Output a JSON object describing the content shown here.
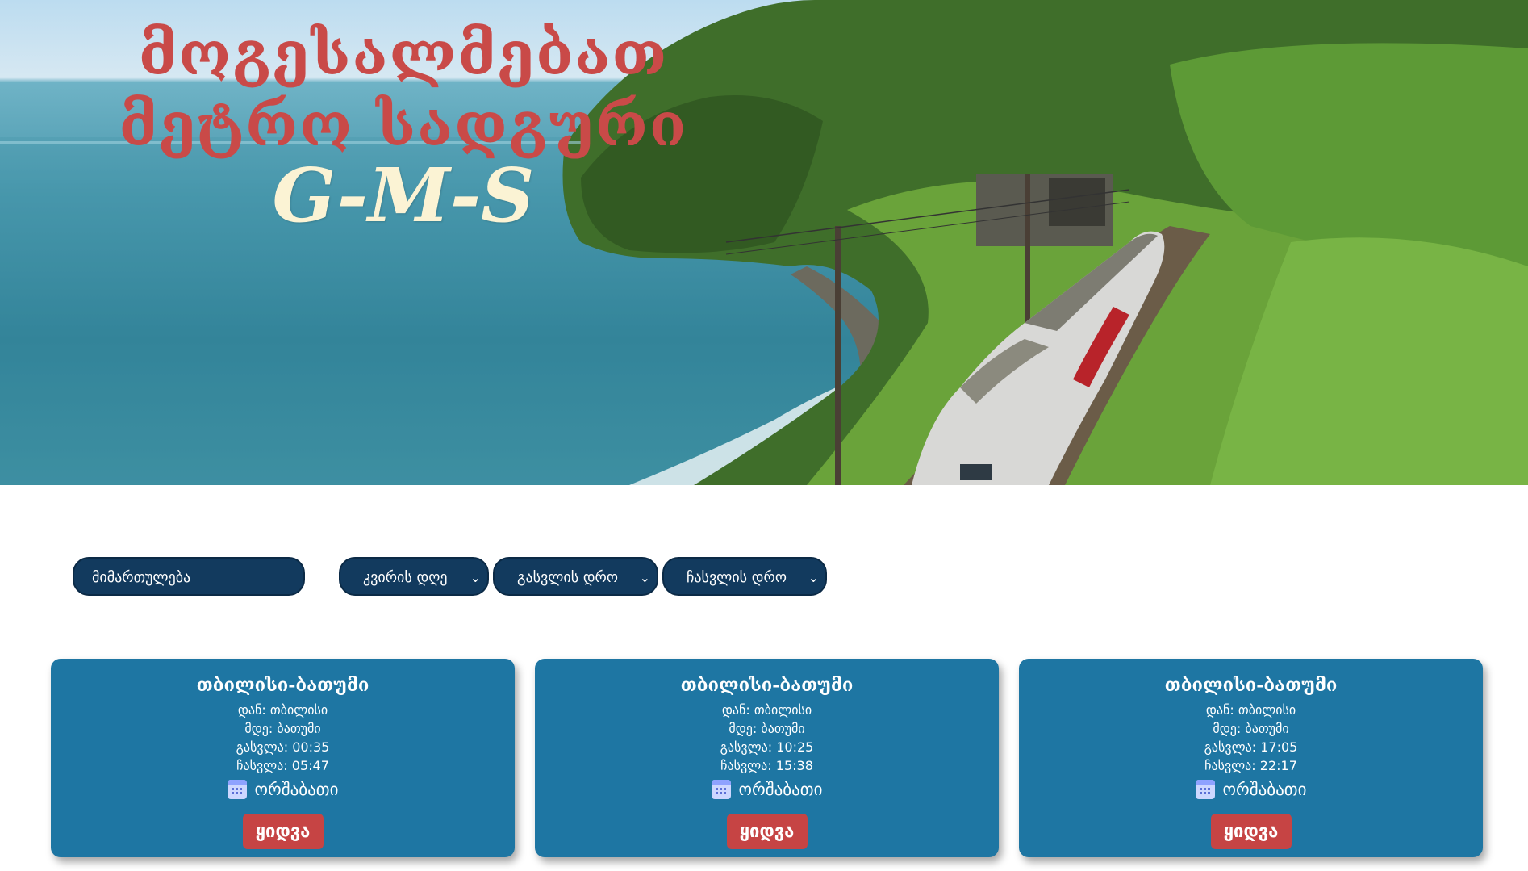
{
  "hero": {
    "title_line1": "მოგესალმებათ",
    "title_line2": "მეტრო სადგური",
    "title_line3": "G-M-S"
  },
  "filters": {
    "direction_placeholder": "მიმართულება",
    "day_select": "კვირის დღე",
    "departure_select": "გასვლის დრო",
    "arrival_select": "ჩასვლის დრო"
  },
  "icons": {
    "chevron": "chevron-down-icon",
    "calendar": "calendar-icon"
  },
  "colors": {
    "title": "#c94a48",
    "title_accent": "#fbf3d4",
    "filter_bg": "#123a5e",
    "card_bg": "#1e76a3",
    "buy_button": "#c64444"
  },
  "cards": [
    {
      "route": "თბილისი-ბათუმი",
      "from": "დან: თბილისი",
      "to": "მდე: ბათუმი",
      "departure": "გასვლა: 00:35",
      "arrival": "ჩასვლა: 05:47",
      "day": "ორშაბათი",
      "buy_label": "ყიდვა"
    },
    {
      "route": "თბილისი-ბათუმი",
      "from": "დან: თბილისი",
      "to": "მდე: ბათუმი",
      "departure": "გასვლა: 10:25",
      "arrival": "ჩასვლა: 15:38",
      "day": "ორშაბათი",
      "buy_label": "ყიდვა"
    },
    {
      "route": "თბილისი-ბათუმი",
      "from": "დან: თბილისი",
      "to": "მდე: ბათუმი",
      "departure": "გასვლა: 17:05",
      "arrival": "ჩასვლა: 22:17",
      "day": "ორშაბათი",
      "buy_label": "ყიდვა"
    }
  ]
}
